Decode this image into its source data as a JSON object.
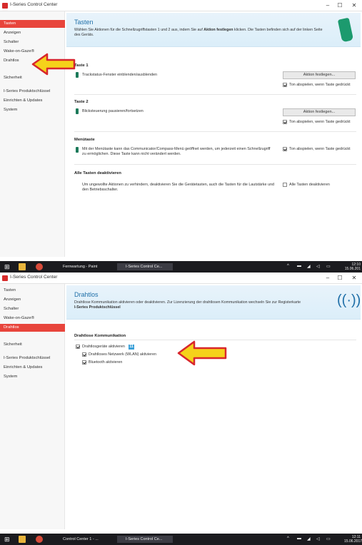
{
  "window_title": "I-Series Control Center",
  "window_controls": {
    "minimize": "–",
    "maximize": "☐",
    "close": "✕"
  },
  "shot1": {
    "sidebar": [
      "Tasten",
      "Anzeigen",
      "Schalter",
      "Wake-on-Gaze®",
      "Drahtlos",
      "Sicherheit",
      "I-Series Produktschlüssel",
      "Einrichten & Updates",
      "System"
    ],
    "active_index": 0,
    "header": {
      "title": "Tasten",
      "desc_pre": "Wählen Sie Aktionen für die Schnellzugriffstasten 1 und 2 aus, indem Sie auf ",
      "desc_bold": "Aktion festlegen",
      "desc_post": " klicken. Die Tasten befinden sich auf der linken Seite des Geräts."
    },
    "taste1": {
      "heading": "Taste 1",
      "text": "Trackstatus-Fenster einblenden/ausblenden",
      "button": "Aktion festlegen...",
      "checkbox": "Ton abspielen, wenn Taste gedrückt"
    },
    "taste2": {
      "heading": "Taste 2",
      "text": "Blicksteuerung pausieren/fortsetzen",
      "button": "Aktion festlegen...",
      "checkbox": "Ton abspielen, wenn Taste gedrückt"
    },
    "menutaste": {
      "heading": "Menütaste",
      "text": "Mit der Menütaste kann das Communicator/Compass-Menü geöffnet werden, um jederzeit einen Schnellzugriff zu ermöglichen. Diese Taste kann nicht verändert werden.",
      "checkbox": "Ton abspielen, wenn Taste gedrückt"
    },
    "deaktivieren": {
      "heading": "Alle Tasten deaktivieren",
      "text": "Um ungewollte Aktionen zu verhindern, deaktivieren Sie die Gerätetasten, auch die Tasten für die Lautstärke und den Betriebsschalter.",
      "checkbox": "Alle Tasten deaktivieren"
    },
    "taskbar": {
      "items": [
        "Fernwartung - Paint",
        "I-Series Control Ce..."
      ],
      "clock_time": "12:10",
      "clock_date": "15.06.201"
    }
  },
  "shot2": {
    "sidebar": [
      "Tasten",
      "Anzeigen",
      "Schalter",
      "Wake-on-Gaze®",
      "Drahtlos",
      "Sicherheit",
      "I-Series Produktschlüssel",
      "Einrichten & Updates",
      "System"
    ],
    "active_index": 4,
    "header": {
      "title": "Drahtlos",
      "desc": "Drahtlose Kommunikation aktivieren oder deaktivieren. Zur Lizenzierung der drahtlosen Kommunikation wechseln Sie zur Registerkarte",
      "desc_bold": "I-Series Produktschlüssel"
    },
    "section": "Drahtlose Kommunikation",
    "options": [
      "Drahtlosgeräte aktivieren",
      "Drahtloses Netzwerk (WLAN) aktivieren",
      "Bluetooth aktivieren"
    ],
    "badge": "11",
    "taskbar": {
      "items": [
        "Control Center 1 - ...",
        "I-Series Control Ce..."
      ],
      "clock_time": "12:11",
      "clock_date": "15.06.2017"
    }
  },
  "colors": {
    "accent": "#e8453c",
    "header_title": "#1f6fa8",
    "arrow_fill": "#f5d21a",
    "arrow_stroke": "#d8262c"
  }
}
